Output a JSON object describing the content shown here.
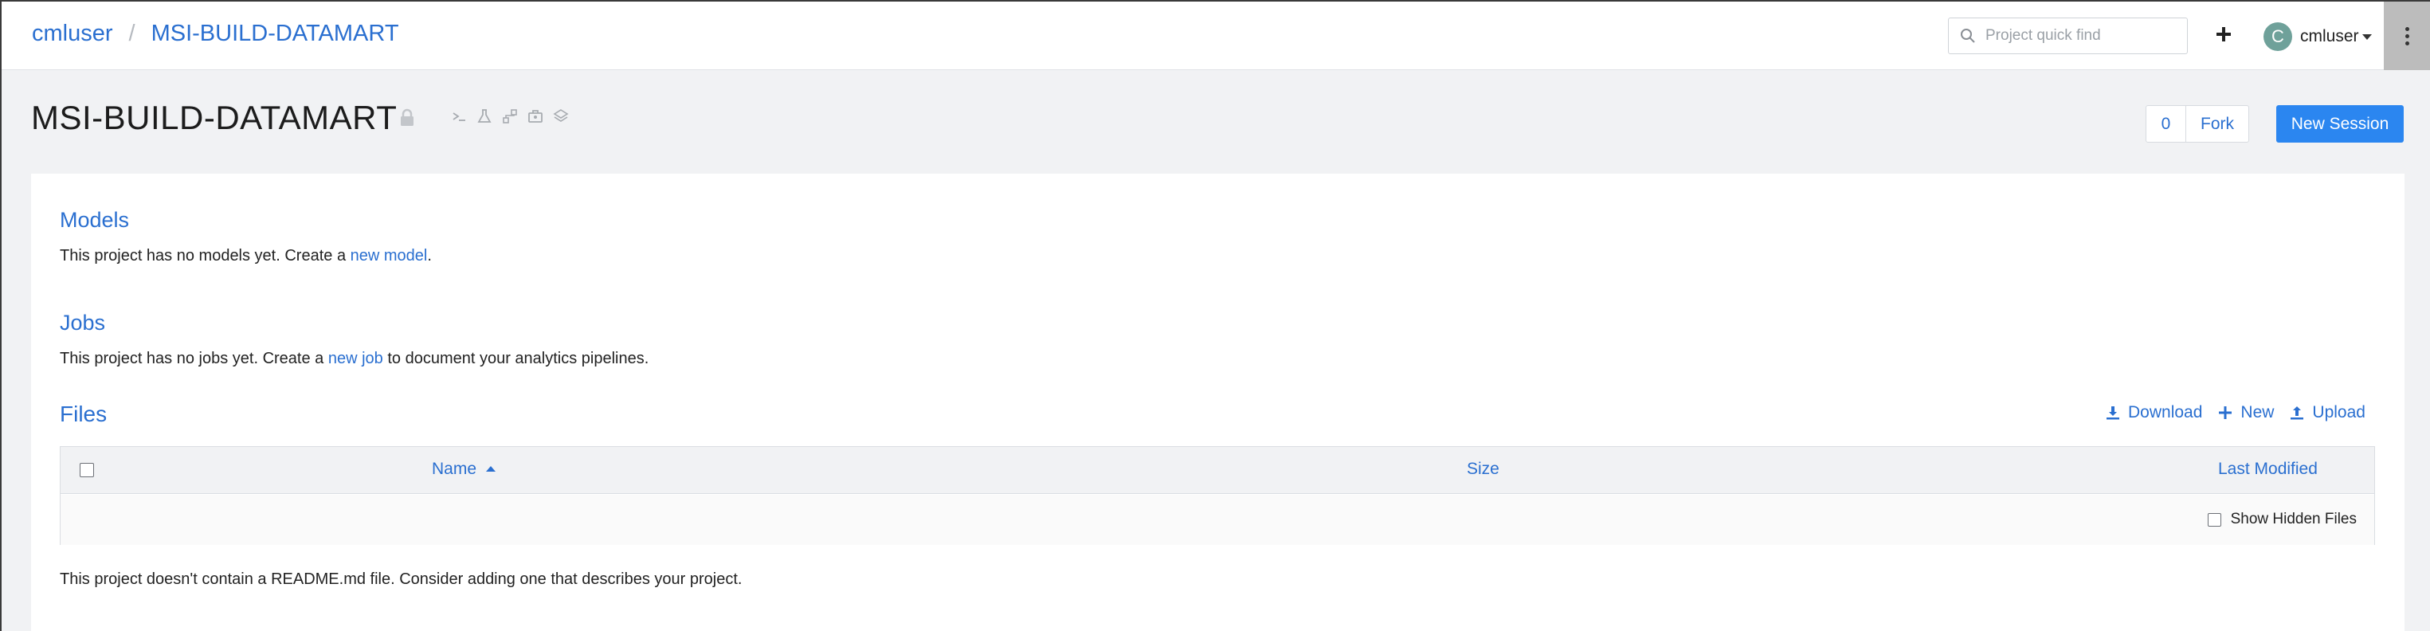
{
  "breadcrumb": {
    "user": "cmluser",
    "separator": "/",
    "project": "MSI-BUILD-DATAMART"
  },
  "search": {
    "placeholder": "Project quick find",
    "value": ""
  },
  "user_menu": {
    "avatar_initial": "C",
    "username": "cmluser"
  },
  "project": {
    "title": "MSI-BUILD-DATAMART",
    "fork_count": "0",
    "fork_label": "Fork",
    "new_session_label": "New Session"
  },
  "models": {
    "title": "Models",
    "text_before": "This project has no models yet. Create a ",
    "link": "new model",
    "text_after": "."
  },
  "jobs": {
    "title": "Jobs",
    "text_before": "This project has no jobs yet. Create a ",
    "link": "new job",
    "text_after": " to document your analytics pipelines."
  },
  "files": {
    "title": "Files",
    "actions": {
      "download": "Download",
      "new": "New",
      "upload": "Upload"
    },
    "columns": {
      "name": "Name",
      "size": "Size",
      "last_modified": "Last Modified"
    },
    "show_hidden_label": "Show Hidden Files"
  },
  "readme_notice": "This project doesn't contain a README.md file. Consider adding one that describes your project.",
  "colors": {
    "accent": "#2a6fd0",
    "primary_button": "#2b86f0",
    "avatar": "#6fa19a"
  },
  "icons": [
    "search-icon",
    "plus-icon",
    "chevron-down-icon",
    "kebab-menu-icon",
    "lock-icon",
    "terminal-icon",
    "flask-icon",
    "workflow-icon",
    "briefcase-icon",
    "layers-icon",
    "download-icon",
    "plus-icon",
    "upload-icon",
    "sort-ascending-icon"
  ]
}
